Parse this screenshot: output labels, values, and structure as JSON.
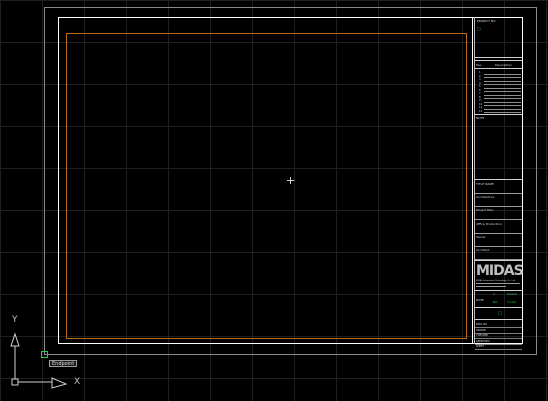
{
  "colors": {
    "background": "#000000",
    "paper_outline": "#8a8a8a",
    "sheet_border": "#ffffff",
    "drawing_area": "#b56a1e",
    "osnap_marker": "#2ecc40"
  },
  "title_block": {
    "project_label": "PROJECT NO",
    "revision_header": "Rev",
    "revision_desc_header": "Description",
    "revision_numbers": [
      "1",
      "2",
      "3",
      "4",
      "5",
      "6",
      "7",
      "8",
      "9",
      "10",
      "11",
      "12"
    ],
    "notes_label": "NOTE",
    "fields": [
      "TITLE NAME",
      "Architecture",
      "Project title",
      "Office Production",
      "Owner",
      "Architect"
    ],
    "logo_text": "MIDAS",
    "logo_tagline": "MIDAS Information Technology Co., Ltd.",
    "scale_row": [
      "A",
      "SCALE"
    ],
    "date_row": [
      "DATE",
      "NO",
      "1:100"
    ],
    "bottom_rows": [
      "DWG NO",
      "DRAWN",
      "CHECKED",
      "APPROVED",
      "SHEET"
    ]
  },
  "osnap_tooltip": "Endpoint",
  "ucs": {
    "x_label": "X",
    "y_label": "Y"
  }
}
